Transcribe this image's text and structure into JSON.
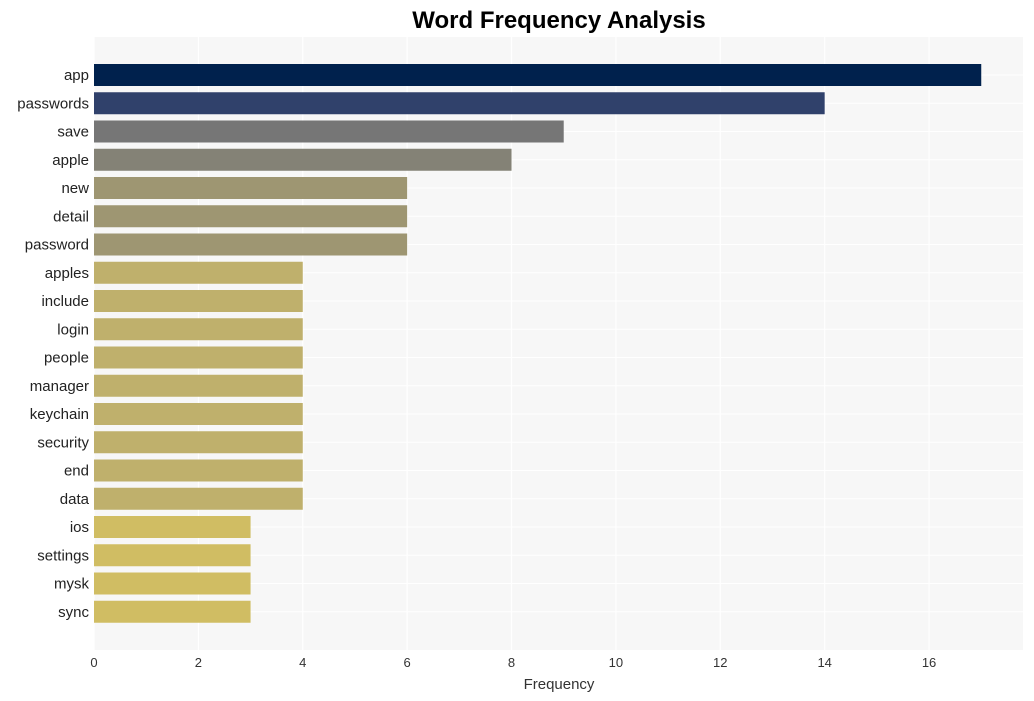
{
  "chart_data": {
    "type": "bar",
    "orientation": "horizontal",
    "title": "Word Frequency Analysis",
    "xlabel": "Frequency",
    "ylabel": "",
    "xlim": [
      0,
      17.8
    ],
    "xticks": [
      0,
      2,
      4,
      6,
      8,
      10,
      12,
      14,
      16
    ],
    "grid": true,
    "legend": "none",
    "categories": [
      "app",
      "passwords",
      "save",
      "apple",
      "new",
      "detail",
      "password",
      "apples",
      "include",
      "login",
      "people",
      "manager",
      "keychain",
      "security",
      "end",
      "data",
      "ios",
      "settings",
      "mysk",
      "sync"
    ],
    "values": [
      17,
      14,
      9,
      8,
      6,
      6,
      6,
      4,
      4,
      4,
      4,
      4,
      4,
      4,
      4,
      4,
      3,
      3,
      3,
      3
    ],
    "colors": [
      "#00214d",
      "#30416b",
      "#767676",
      "#848276",
      "#9e9672",
      "#9e9672",
      "#9e9672",
      "#bfb06c",
      "#bfb06c",
      "#bfb06c",
      "#bfb06c",
      "#bfb06c",
      "#bfb06c",
      "#bfb06c",
      "#bfb06c",
      "#bfb06c",
      "#d0bd63",
      "#d0bd63",
      "#d0bd63",
      "#d0bd63"
    ],
    "plot_background": "#f7f7f7",
    "grid_color": "#ffffff"
  }
}
